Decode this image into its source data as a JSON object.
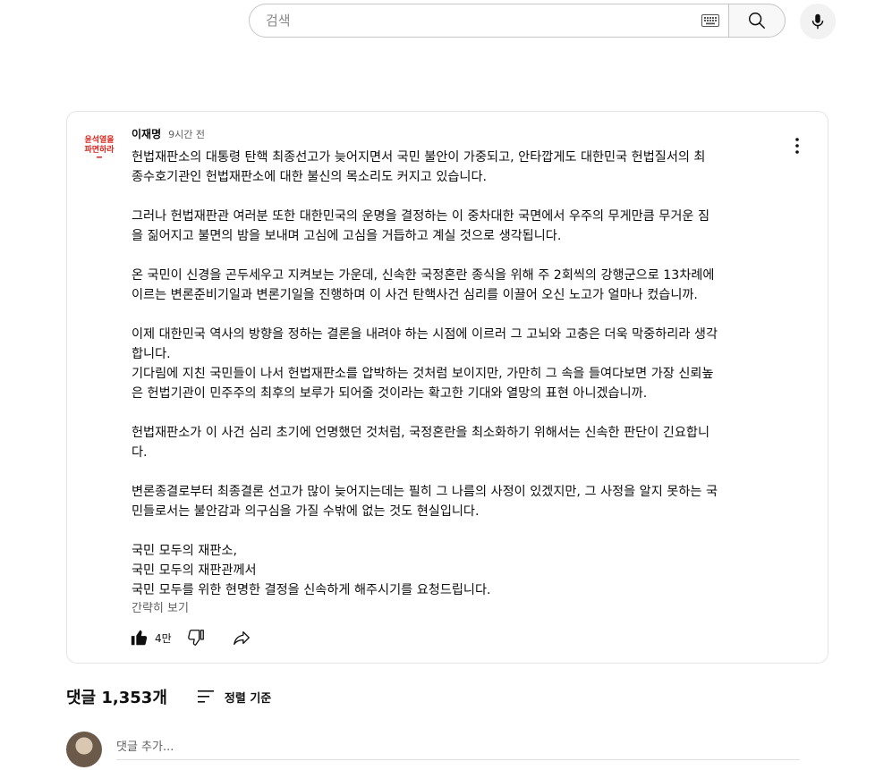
{
  "search": {
    "placeholder": "검색"
  },
  "icons": {
    "keyboard": "keyboard-icon",
    "search": "search-icon",
    "mic": "mic-icon",
    "menu": "more-vert-icon",
    "like": "thumb-up-icon",
    "dislike": "thumb-down-icon",
    "share": "share-icon",
    "sort": "sort-icon"
  },
  "post": {
    "author": "이재명",
    "time": "9시간 전",
    "logo_text": [
      "윤석열을",
      "파면하라"
    ],
    "lines": [
      "헌법재판소의 대통령 탄핵 최종선고가 늦어지면서 국민 불안이 가중되고, 안타깝게도 대한민국 헌법질서의 최",
      "종수호기관인 헌법재판소에 대한 불신의 목소리도 커지고 있습니다.",
      "",
      "그러나 헌법재판관 여러분 또한 대한민국의 운명을 결정하는 이 중차대한 국면에서 우주의 무게만큼 무거운 짐",
      "을 짊어지고 불면의 밤을 보내며 고심에 고심을 거듭하고 계실 것으로 생각됩니다.",
      "",
      "온 국민이 신경을 곤두세우고 지켜보는 가운데, 신속한 국정혼란 종식을 위해 주 2회씩의 강행군으로 13차례에",
      "이르는 변론준비기일과 변론기일을 진행하며 이 사건 탄핵사건 심리를 이끌어 오신 노고가 얼마나 컸습니까.",
      "",
      "이제 대한민국 역사의 방향을 정하는 결론을 내려야 하는 시점에 이르러 그 고뇌와 고충은 더욱 막중하리라 생각",
      "합니다.",
      "기다림에 지친 국민들이 나서 헌법재판소를 압박하는 것처럼 보이지만, 가만히 그 속을 들여다보면 가장 신뢰높",
      "은 헌법기관이 민주주의 최후의 보루가 되어줄 것이라는 확고한 기대와 열망의 표현 아니겠습니까.",
      "",
      "헌법재판소가 이 사건 심리 초기에 언명했던 것처럼, 국정혼란을 최소화하기 위해서는 신속한 판단이 긴요합니",
      "다.",
      "",
      "변론종결로부터 최종결론 선고가 많이 늦어지는데는 필히 그 나름의 사정이 있겠지만, 그 사정을 알지 못하는 국",
      "민들로서는 불안감과 의구심을 가질 수밖에 없는 것도 현실입니다.",
      "",
      "국민 모두의 재판소,",
      "국민 모두의 재판관께서",
      "국민 모두를 위한 현명한 결정을 신속하게 해주시기를 요청드립니다."
    ],
    "collapse_label": "간략히 보기",
    "like_count": "4만"
  },
  "comments": {
    "count_label": "댓글 1,353개",
    "sort_label": "정렬 기준",
    "add_placeholder": "댓글 추가..."
  },
  "colors": {
    "text": "#0f0f0f",
    "secondary": "#606060",
    "logo_red": "#d7261e"
  }
}
